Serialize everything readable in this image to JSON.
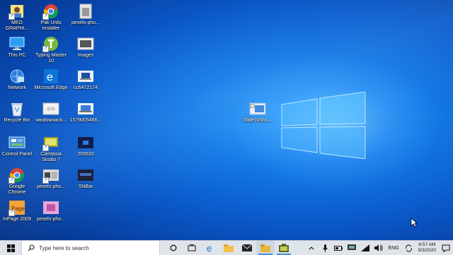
{
  "desktop": {
    "icons": [
      {
        "label": "MEO GRAPHI...",
        "icon": "person-app-icon"
      },
      {
        "label": "Pak Urdu Installer",
        "icon": "chrome-icon"
      },
      {
        "label": "pexels-pho...",
        "icon": "image-file-icon"
      },
      {
        "label": "This PC",
        "icon": "computer-icon"
      },
      {
        "label": "Typing Master 10",
        "icon": "typing-master-icon"
      },
      {
        "label": "images",
        "icon": "image-file-icon"
      },
      {
        "label": "Network",
        "icon": "network-icon"
      },
      {
        "label": "Microsoft Edge",
        "icon": "edge-icon"
      },
      {
        "label": "cc6472174",
        "icon": "laptop-image-icon"
      },
      {
        "label": "Recycle Bin",
        "icon": "recycle-bin-icon"
      },
      {
        "label": "windowsacti...",
        "icon": "image-file-icon"
      },
      {
        "label": "1579005466...",
        "icon": "laptop-image-icon"
      },
      {
        "label": "Control Panel",
        "icon": "control-panel-icon"
      },
      {
        "label": "Camtasia Studio 7",
        "icon": "camtasia-icon"
      },
      {
        "label": "205633",
        "icon": "dark-image-icon"
      },
      {
        "label": "Google Chrome",
        "icon": "chrome-icon"
      },
      {
        "label": "pexels-pho...",
        "icon": "image-file-icon"
      },
      {
        "label": "SNBar",
        "icon": "dark-image-icon"
      },
      {
        "label": "InPage 2009",
        "icon": "inpage-icon"
      },
      {
        "label": "pexels-pho...",
        "icon": "image-file-icon"
      }
    ],
    "floating_icon": {
      "label": "SlideToShu...",
      "icon": "slide-to-shutdown-icon"
    }
  },
  "taskbar": {
    "search_placeholder": "Type here to search",
    "apps": [
      "task-view-icon",
      "edge-icon",
      "file-explorer-icon",
      "mail-icon",
      "folder-icon",
      "camtasia-icon"
    ],
    "language": "ENG",
    "time": "8:57 AM",
    "date": "5/3/2020"
  },
  "colors": {
    "accent": "#1479e6",
    "taskbar": "#dfe3ea"
  }
}
